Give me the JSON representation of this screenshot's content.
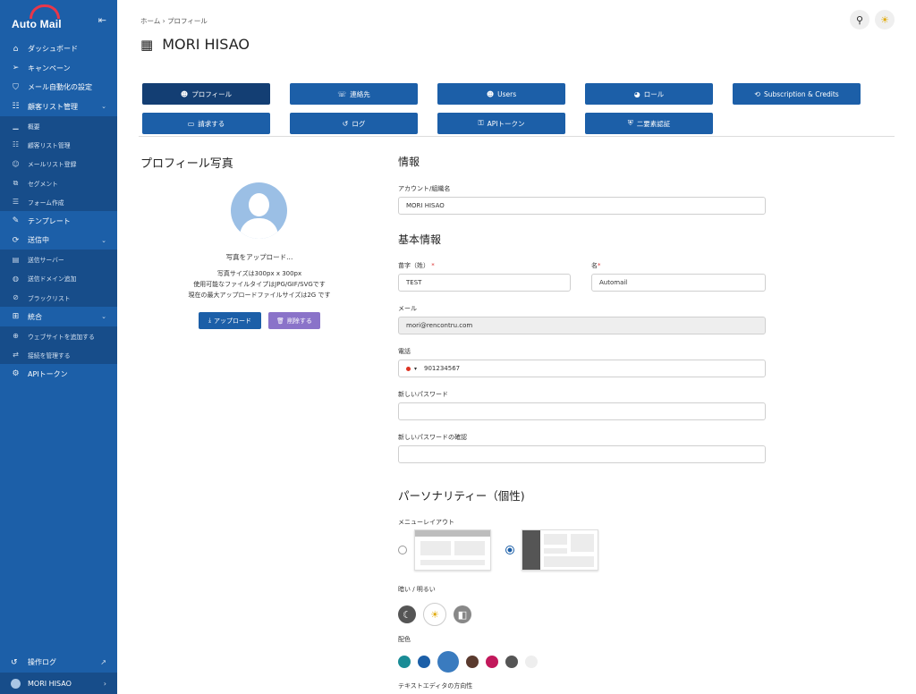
{
  "brand": {
    "name": "Auto Mail"
  },
  "sidebar": {
    "items": [
      {
        "label": "ダッシュボード",
        "icon": "home-icon",
        "kind": "top"
      },
      {
        "label": "キャンペーン",
        "icon": "send-icon",
        "kind": "top"
      },
      {
        "label": "メール自動化の設定",
        "icon": "shield-icon",
        "kind": "top"
      },
      {
        "label": "顧客リスト管理",
        "icon": "list-icon",
        "kind": "top",
        "chev": "⌄"
      },
      {
        "label": "概要",
        "icon": "chart-icon",
        "kind": "sub"
      },
      {
        "label": "顧客リスト管理",
        "icon": "list-icon",
        "kind": "sub"
      },
      {
        "label": "メールリスト登録",
        "icon": "user-icon",
        "kind": "sub"
      },
      {
        "label": "セグメント",
        "icon": "segment-icon",
        "kind": "sub"
      },
      {
        "label": "フォーム作成",
        "icon": "form-icon",
        "kind": "sub"
      },
      {
        "label": "テンプレート",
        "icon": "template-icon",
        "kind": "top"
      },
      {
        "label": "送信中",
        "icon": "sync-icon",
        "kind": "top",
        "chev": "⌄"
      },
      {
        "label": "送信サーバー",
        "icon": "server-icon",
        "kind": "sub"
      },
      {
        "label": "送信ドメイン追加",
        "icon": "globe-icon",
        "kind": "sub"
      },
      {
        "label": "ブラックリスト",
        "icon": "block-user-icon",
        "kind": "sub"
      },
      {
        "label": "統合",
        "icon": "integration-icon",
        "kind": "top",
        "chev": "⌄"
      },
      {
        "label": "ウェブサイトを追加する",
        "icon": "site-add-icon",
        "kind": "sub"
      },
      {
        "label": "接続を管理する",
        "icon": "connection-icon",
        "kind": "sub"
      },
      {
        "label": "APIトークン",
        "icon": "gear-icon",
        "kind": "top"
      }
    ],
    "footer": {
      "log_label": "操作ログ",
      "user_name": "MORI HISAO"
    }
  },
  "breadcrumb": {
    "home": "ホーム",
    "sep": "›",
    "current": "プロフィール"
  },
  "page": {
    "title": "MORI HISAO"
  },
  "tabs": [
    {
      "label": "プロフィール",
      "icon": "smile-icon",
      "active": true
    },
    {
      "label": "連絡先",
      "icon": "contacts-icon"
    },
    {
      "label": "Users",
      "icon": "users-icon"
    },
    {
      "label": "ロール",
      "icon": "role-icon"
    },
    {
      "label": "Subscription & Credits",
      "icon": "subscription-icon"
    },
    {
      "label": "請求する",
      "icon": "card-icon"
    },
    {
      "label": "ログ",
      "icon": "history-icon"
    },
    {
      "label": "APIトークン",
      "icon": "key-icon"
    },
    {
      "label": "二要素認証",
      "icon": "shield-check-icon"
    }
  ],
  "photo": {
    "heading": "プロフィール写真",
    "upload_hint": "写真をアップロード...",
    "size_note": "写真サイズは300px x 300px",
    "types_note": "使用可能なファイルタイプはJPG/GIF/SVGです",
    "max_note": "現在の最大アップロードファイルサイズは2G です",
    "upload_button": "アップロード",
    "delete_button": "削除する"
  },
  "info": {
    "heading": "情報",
    "account_label": "アカウント/組織名",
    "account_value": "MORI HISAO"
  },
  "basic": {
    "heading": "基本情報",
    "last_name_label": "苗字（姓）",
    "last_name_value": "TEST",
    "first_name_label": "名",
    "first_name_value": "Automail",
    "email_label": "メール",
    "email_value": "mori@rencontru.com",
    "phone_label": "電話",
    "phone_value": "901234567",
    "new_password_label": "新しいパスワード",
    "confirm_password_label": "新しいパスワードの確認"
  },
  "personality": {
    "heading": "パーソナリティー（個性)",
    "menu_layout_label": "メニューレイアウト",
    "theme_label": "暗い / 明るい",
    "color_label": "配色",
    "colors": [
      "#1a8c96",
      "#1c5fa8",
      "#3a7bbf",
      "#5a3a2e",
      "#c2185b",
      "#555555",
      "#eeeeee"
    ],
    "text_direction_label": "テキストエディタの方向性"
  }
}
